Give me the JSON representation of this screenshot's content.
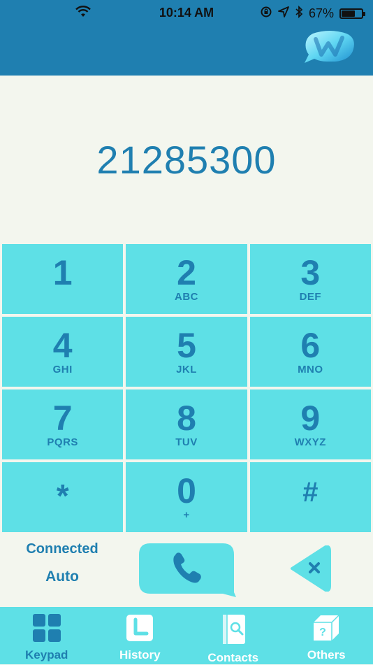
{
  "status_bar": {
    "time": "10:14 AM",
    "battery": "67%",
    "battery_level": 0.67
  },
  "header": {
    "logo_icon": "speech-bubble-logo-icon"
  },
  "display": {
    "number": "21285300"
  },
  "keypad": [
    {
      "digit": "1",
      "letters": ""
    },
    {
      "digit": "2",
      "letters": "ABC"
    },
    {
      "digit": "3",
      "letters": "DEF"
    },
    {
      "digit": "4",
      "letters": "GHI"
    },
    {
      "digit": "5",
      "letters": "JKL"
    },
    {
      "digit": "6",
      "letters": "MNO"
    },
    {
      "digit": "7",
      "letters": "PQRS"
    },
    {
      "digit": "8",
      "letters": "TUV"
    },
    {
      "digit": "9",
      "letters": "WXYZ"
    },
    {
      "digit": "*",
      "letters": ""
    },
    {
      "digit": "0",
      "letters": "+"
    },
    {
      "digit": "#",
      "letters": ""
    }
  ],
  "actions": {
    "connection_status": "Connected",
    "mode": "Auto",
    "call_icon": "phone-icon",
    "delete_icon": "backspace-icon"
  },
  "tabs": [
    {
      "label": "Keypad",
      "icon": "keypad-grid-icon",
      "active": true
    },
    {
      "label": "History",
      "icon": "clock-icon",
      "active": false
    },
    {
      "label": "Contacts",
      "icon": "contacts-book-icon",
      "active": false
    },
    {
      "label": "Others",
      "icon": "box-question-icon",
      "active": false
    }
  ],
  "colors": {
    "header": "#1f7fb0",
    "accent": "#5ee0e6",
    "text": "#1f7fb0",
    "background": "#f3f6ee"
  }
}
